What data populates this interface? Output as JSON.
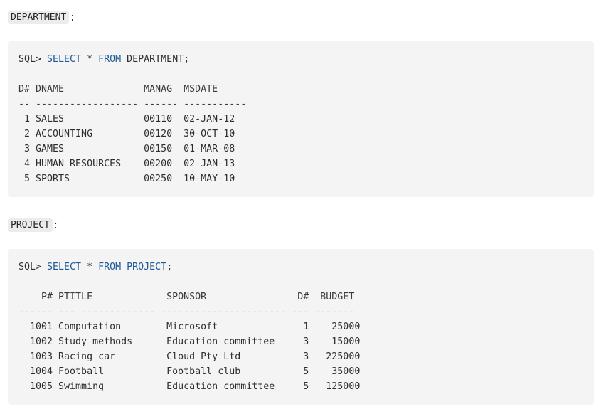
{
  "department_section": {
    "label": "DEPARTMENT",
    "colon": ":",
    "query": {
      "prompt": "SQL> ",
      "select": "SELECT",
      "star": " * ",
      "from": "FROM",
      "table": " DEPARTMENT",
      "semicolon": ";"
    },
    "header_line": "D# DNAME              MANAG  MSDATE",
    "separator_line": "-- ------------------ ------ -----------",
    "rows": [
      " 1 SALES              00110  02-JAN-12",
      " 2 ACCOUNTING         00120  30-OCT-10",
      " 3 GAMES              00150  01-MAR-08",
      " 4 HUMAN RESOURCES    00200  02-JAN-13",
      " 5 SPORTS             00250  10-MAY-10"
    ]
  },
  "project_section": {
    "label": "PROJECT",
    "colon": ":",
    "query": {
      "prompt": "SQL> ",
      "select": "SELECT",
      "star": " * ",
      "from": "FROM",
      "table": " PROJECT",
      "semicolon": ";"
    },
    "header_line": "    P# PTITLE             SPONSOR                D#  BUDGET",
    "separator_line": "------ --- ------------- ---------------------- --- -------",
    "rows": [
      "  1001 Computation        Microsoft               1    25000",
      "  1002 Study methods      Education committee     3    15000",
      "  1003 Racing car         Cloud Pty Ltd           3   225000",
      "  1004 Football           Football club           5    35000",
      "  1005 Swimming           Education committee     5   125000"
    ]
  },
  "colors": {
    "code_background": "#f4f4f4",
    "keyword": "#1f5a96",
    "inline_code_background": "#ececec"
  }
}
